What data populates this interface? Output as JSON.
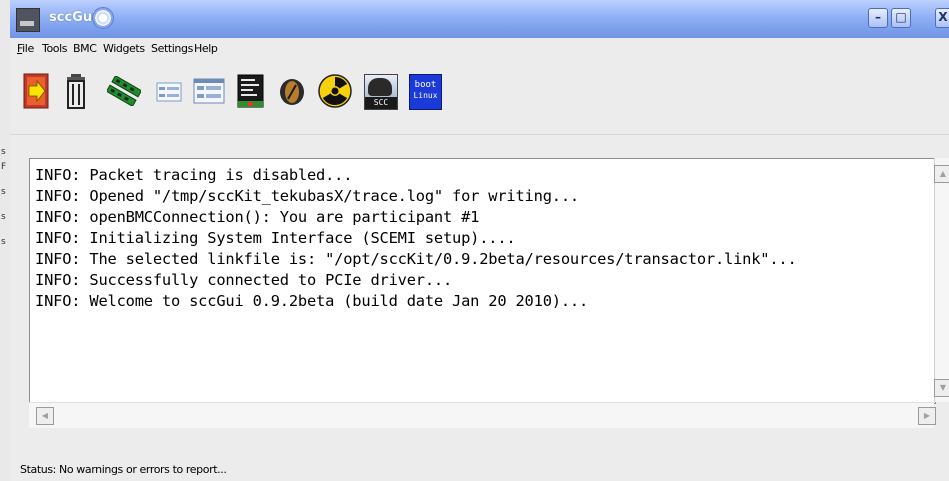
{
  "window": {
    "title": "sccGui"
  },
  "title_buttons": {
    "minimize": "–",
    "maximize": "□",
    "close": "X"
  },
  "menu": [
    {
      "key": "F",
      "rest": "ile"
    },
    {
      "key": "",
      "rest": "Tools"
    },
    {
      "key": "",
      "rest": "BMC"
    },
    {
      "key": "",
      "rest": "Widgets"
    },
    {
      "key": "",
      "rest": "Settings"
    },
    {
      "key": "",
      "rest": "Help"
    }
  ],
  "toolbar": {
    "scc_label": "SCC",
    "boot_linux_line1": "boot",
    "boot_linux_line2": "Linux"
  },
  "log_lines": [
    "INFO: Packet tracing is disabled...",
    "INFO: Opened \"/tmp/sccKit_tekubasX/trace.log\" for writing...",
    "INFO: openBMCConnection(): You are participant #1",
    "INFO: Initializing System Interface (SCEMI setup)....",
    "INFO: The selected linkfile is: \"/opt/sccKit/0.9.2beta/resources/transactor.link\"...",
    "INFO: Successfully connected to PCIe driver...",
    "INFO: Welcome to sccGui 0.9.2beta (build date Jan 20 2010)..."
  ],
  "status": "Status: No warnings or errors to report...",
  "left_strip_letters": [
    "s",
    "F",
    "s",
    "s",
    "s"
  ],
  "colors": {
    "titlebar": "#8fb0f5",
    "window_bg": "#ececec",
    "boot_linux_bg": "#1c3ad8"
  }
}
